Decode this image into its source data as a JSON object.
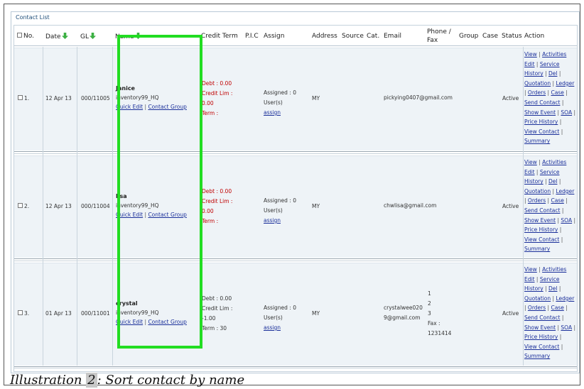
{
  "panel_title": "Contact List",
  "columns": {
    "no": "No.",
    "date": "Date",
    "gl": "GL",
    "name": "Name",
    "credit_term": "Credit Term",
    "pic": "P.I.C",
    "assign": "Assign",
    "address": "Address",
    "source": "Source",
    "cat": "Cat.",
    "email": "Email",
    "phone_fax": "Phone /\nFax",
    "group": "Group",
    "case": "Case",
    "status": "Status",
    "action": "Action"
  },
  "rows": [
    {
      "no": "1.",
      "date": "12 Apr 13",
      "gl": "000/11005",
      "name": "Janice",
      "company": "inventory99_HQ",
      "quick_edit": "Quick Edit",
      "contact_group": "Contact Group",
      "debt": "Debt : 0.00",
      "credit_lim": "Credit Lim :",
      "credit_val": "0.00",
      "term": "Term :",
      "assigned": "Assigned : 0",
      "users": "User(s)",
      "assign_link": "assign",
      "address": "MY",
      "email": "pickying0407@gmail.com",
      "phone_lines": [],
      "status": "Active"
    },
    {
      "no": "2.",
      "date": "12 Apr 13",
      "gl": "000/11004",
      "name": "lisa",
      "company": "inventory99_HQ",
      "quick_edit": "Quick Edit",
      "contact_group": "Contact Group",
      "debt": "Debt : 0.00",
      "credit_lim": "Credit Lim :",
      "credit_val": "0.00",
      "term": "Term :",
      "assigned": "Assigned : 0",
      "users": "User(s)",
      "assign_link": "assign",
      "address": "MY",
      "email": "chwlisa@gmail.com",
      "phone_lines": [],
      "status": "Active"
    },
    {
      "no": "3.",
      "date": "01 Apr 13",
      "gl": "000/11001",
      "name": "crystal",
      "company": "inventory99_HQ",
      "quick_edit": "Quick Edit",
      "contact_group": "Contact Group",
      "debt": "Debt : 0.00",
      "credit_lim": "Credit Lim :",
      "credit_val": "-1.00",
      "term": "Term : 30",
      "assigned": "Assigned : 0",
      "users": "User(s)",
      "assign_link": "assign",
      "address": "MY",
      "email": "crystalwee020",
      "email2": "9@gmail.com",
      "phone_lines": [
        "1",
        "2",
        "3",
        "Fax :",
        "1231414"
      ],
      "status": "Active"
    }
  ],
  "action_links": {
    "view": "View",
    "activities": "Activities",
    "edit": "Edit",
    "service": "Service",
    "history": "History",
    "del": "Del",
    "quotation": "Quotation",
    "ledger": "Ledger",
    "orders": "Orders",
    "case": "Case",
    "send_contact": "Send Contact",
    "show_event": "Show Event",
    "soa": "SOA",
    "price_history": "Price History",
    "view_contact": "View Contact",
    "summary": "Summary"
  },
  "caption": {
    "prefix": "Illustration ",
    "number": "2",
    "text": ": Sort contact by name"
  },
  "colors": {
    "highlight": "#22dd22",
    "sort_arrow": "#3cb043",
    "credit_red": "#c00000",
    "link": "#1a2f9a"
  }
}
